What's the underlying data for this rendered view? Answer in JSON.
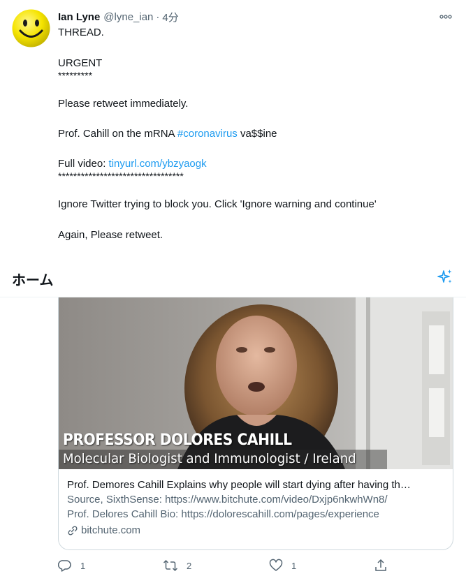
{
  "tweet": {
    "author_name": "Ian Lyne",
    "handle": "@lyne_ian",
    "separator": "·",
    "time": "4分",
    "body": {
      "p1": "THREAD.",
      "p2_l1": "URGENT",
      "p2_l2": "*********",
      "p3": "Please retweet immediately.",
      "p4_pre": "Prof. Cahill on the mRNA ",
      "p4_link": "#coronavirus",
      "p4_post": " va$$ine",
      "p5_pre": "Full video: ",
      "p5_link": "tinyurl.com/ybzyaogk",
      "p5_stars": "*********************************",
      "p6": "Ignore Twitter trying to block you. Click 'Ignore warning and continue'",
      "p7": "Again, Please retweet."
    }
  },
  "home_bar": {
    "title": "ホーム"
  },
  "card": {
    "video_caption_name": "PROFESSOR DOLORES CAHILL",
    "video_caption_role": "Molecular Biologist and Immunologist / Ireland",
    "title": "Prof. Demores Cahill Explains why people will start dying after having th…",
    "desc_line1": "Source, SixthSense: https://www.bitchute.com/video/Dxjp6nkwhWn8/",
    "desc_line2": "Prof. Delores Cahill Bio: https://dolorescahill.com/pages/experience",
    "domain": "bitchute.com"
  },
  "actions": {
    "reply_count": "1",
    "retweet_count": "2",
    "like_count": "1"
  },
  "colors": {
    "link": "#1d9bf0",
    "secondary_text": "#536471",
    "primary_text": "#0f1419",
    "border": "#cfd9de"
  },
  "icons": [
    "smiley-avatar",
    "more-icon",
    "sparkle-icon",
    "link-icon",
    "reply-icon",
    "retweet-icon",
    "like-icon",
    "share-icon"
  ]
}
